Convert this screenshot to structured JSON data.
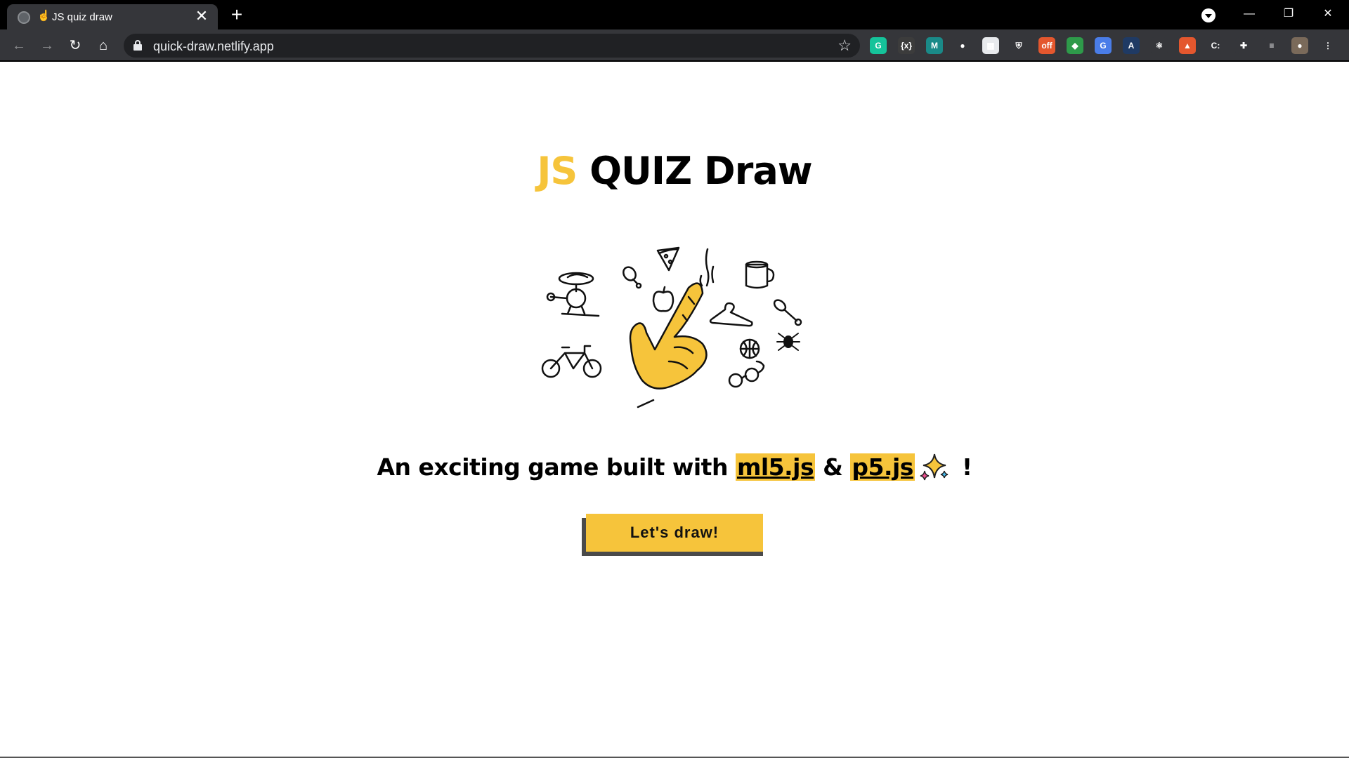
{
  "browser": {
    "tab_title": "JS quiz draw",
    "tab_close": "✕",
    "new_tab": "+",
    "url": "quick-draw.netlify.app",
    "back": "←",
    "forward": "→",
    "reload": "↻",
    "home": "⌂",
    "bookmark_star": "☆",
    "minimize": "—",
    "restore": "❐",
    "close": "✕",
    "extensions": [
      {
        "name": "grammarly-icon",
        "glyph": "G",
        "color": "#15c39a"
      },
      {
        "name": "json-viewer-icon",
        "glyph": "{x}",
        "color": "#3c3c3c"
      },
      {
        "name": "m-extension-icon",
        "glyph": "M",
        "color": "#1a8a88"
      },
      {
        "name": "github-icon",
        "glyph": "●",
        "color": "#35363a"
      },
      {
        "name": "pdf-extension-icon",
        "glyph": "▦",
        "color": "#e8eaed"
      },
      {
        "name": "shield-extension-icon",
        "glyph": "⛨",
        "color": "#35363a"
      },
      {
        "name": "off-toggle-icon",
        "glyph": "off",
        "color": "#e4572e"
      },
      {
        "name": "color-picker-icon",
        "glyph": "◆",
        "color": "#2e9a4a"
      },
      {
        "name": "translate-icon",
        "glyph": "G",
        "color": "#4a7de8"
      },
      {
        "name": "dark-circle-icon",
        "glyph": "A",
        "color": "#1f3a64"
      },
      {
        "name": "react-devtools-icon",
        "glyph": "⚛",
        "color": "#35363a"
      },
      {
        "name": "rocket-extension-icon",
        "glyph": "▲",
        "color": "#e4572e"
      },
      {
        "name": "css-extension-icon",
        "glyph": "C:",
        "color": "#35363a"
      },
      {
        "name": "extensions-puzzle-icon",
        "glyph": "✚",
        "color": "#35363a"
      },
      {
        "name": "reading-list-icon",
        "glyph": "≡",
        "color": "#35363a"
      },
      {
        "name": "profile-avatar-icon",
        "glyph": "●",
        "color": "#7a6a5a"
      },
      {
        "name": "menu-kebab-icon",
        "glyph": "⋮",
        "color": "#35363a"
      }
    ]
  },
  "page": {
    "title_js": "JS",
    "title_rest": " QUIZ Draw",
    "subtitle_prefix": "An exciting game built with ",
    "link_ml5": "ml5.js",
    "amp": " & ",
    "link_p5": "p5.js",
    "exclaim": " !",
    "cta_label": "Let's draw!"
  },
  "colors": {
    "accent": "#f6c43b",
    "chrome_dark": "#000000",
    "toolbar": "#35363a",
    "omnibox": "#202124"
  }
}
